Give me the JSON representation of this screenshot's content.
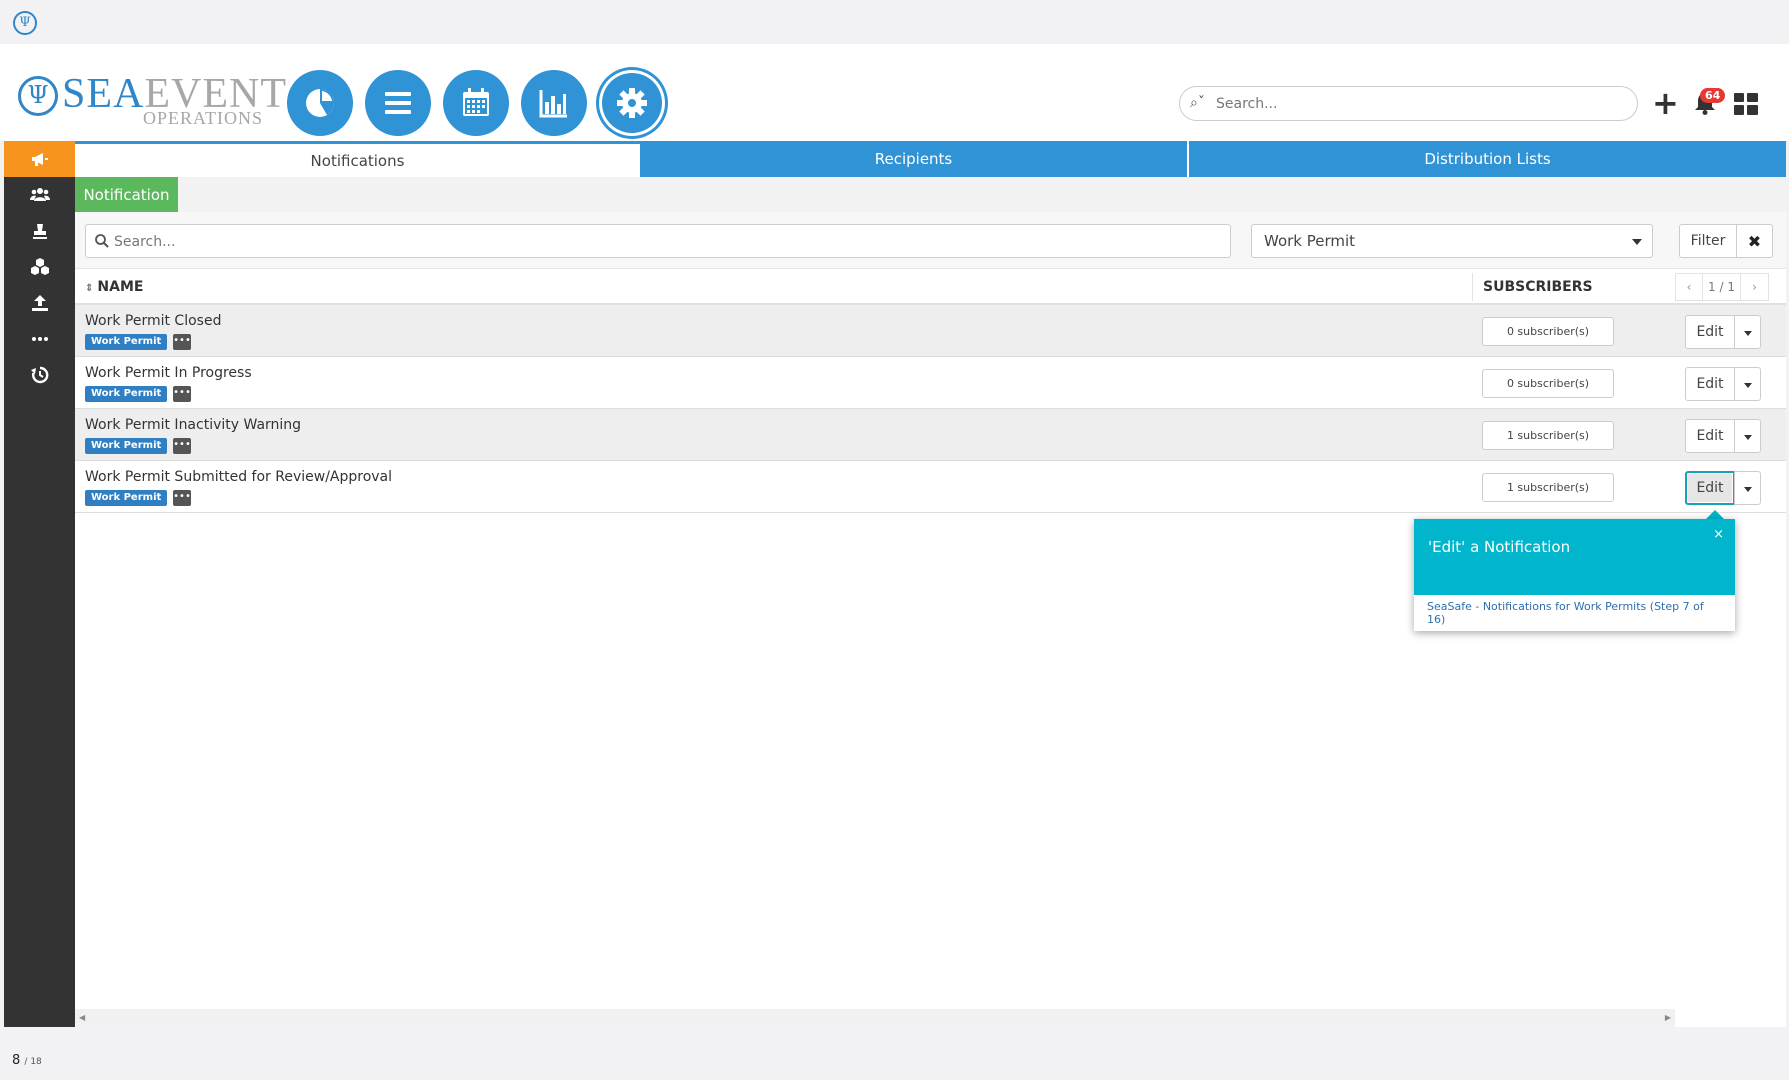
{
  "brand": {
    "name_part1": "SEA",
    "name_part2": "EVENT",
    "sub": "OPERATIONS"
  },
  "header": {
    "search_placeholder": "Search...",
    "notification_count": "64"
  },
  "tabs": [
    {
      "label": "Notifications",
      "active": true
    },
    {
      "label": "Recipients",
      "active": false
    },
    {
      "label": "Distribution Lists",
      "active": false
    }
  ],
  "toolbar": {
    "notification_button": "Notification"
  },
  "filters": {
    "search_placeholder": "Search...",
    "type_selected": "Work Permit",
    "filter_label": "Filter",
    "clear_label": "✖"
  },
  "table": {
    "columns": {
      "name": "NAME",
      "subscribers": "SUBSCRIBERS"
    },
    "pager": {
      "prev": "‹",
      "pages": "1 / 1",
      "next": "›"
    },
    "rows": [
      {
        "name": "Work Permit Closed",
        "tag": "Work Permit",
        "more": "•••",
        "subscribers": "0 subscriber(s)",
        "edit": "Edit"
      },
      {
        "name": "Work Permit In Progress",
        "tag": "Work Permit",
        "more": "•••",
        "subscribers": "0 subscriber(s)",
        "edit": "Edit"
      },
      {
        "name": "Work Permit Inactivity Warning",
        "tag": "Work Permit",
        "more": "•••",
        "subscribers": "1 subscriber(s)",
        "edit": "Edit"
      },
      {
        "name": "Work Permit Submitted for Review/Approval",
        "tag": "Work Permit",
        "more": "•••",
        "subscribers": "1 subscriber(s)",
        "edit": "Edit"
      }
    ]
  },
  "popover": {
    "title": "'Edit' a Notification",
    "close": "×",
    "link": "SeaSafe - Notifications for Work Permits (Step 7 of 16)"
  },
  "footer": {
    "page_current": "8",
    "page_total": "/ 18"
  },
  "colors": {
    "brand_blue": "#2f93d6",
    "active_orange": "#f7941d",
    "success_green": "#5cb85c",
    "popover_teal": "#00b5cc",
    "tag_blue": "#2f7fc2"
  }
}
